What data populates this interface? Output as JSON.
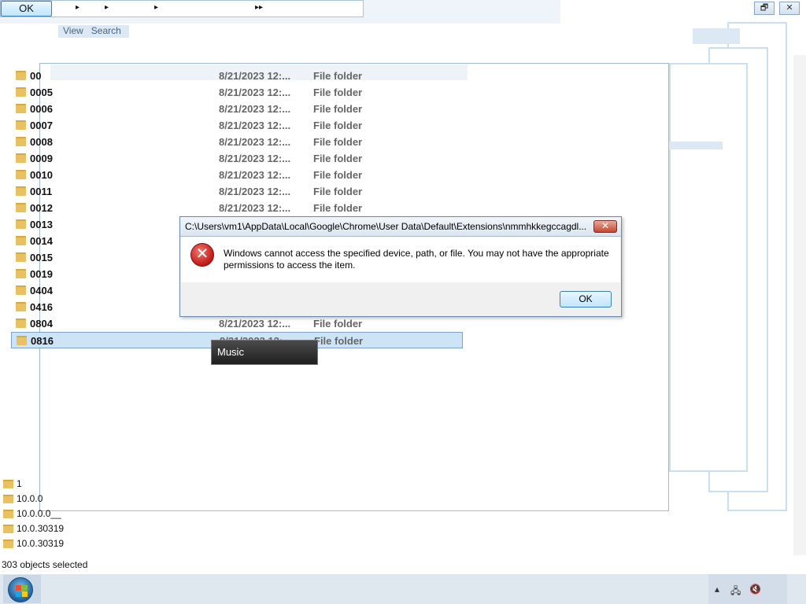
{
  "topbar": {
    "ok_label": "OK",
    "arrows": [
      "▸",
      "▸",
      "▸",
      "▸▸"
    ],
    "menu": [
      "View",
      "Search"
    ]
  },
  "window_buttons": {
    "restore": "🗗",
    "close": "✕"
  },
  "file_list": [
    {
      "name": "00",
      "date": "8/21/2023 12:...",
      "type": "File folder"
    },
    {
      "name": "0005",
      "date": "8/21/2023 12:...",
      "type": "File folder"
    },
    {
      "name": "0006",
      "date": "8/21/2023 12:...",
      "type": "File folder"
    },
    {
      "name": "0007",
      "date": "8/21/2023 12:...",
      "type": "File folder"
    },
    {
      "name": "0008",
      "date": "8/21/2023 12:...",
      "type": "File folder"
    },
    {
      "name": "0009",
      "date": "8/21/2023 12:...",
      "type": "File folder"
    },
    {
      "name": "0010",
      "date": "8/21/2023 12:...",
      "type": "File folder"
    },
    {
      "name": "0011",
      "date": "8/21/2023 12:...",
      "type": "File folder"
    },
    {
      "name": "0012",
      "date": "8/21/2023 12:...",
      "type": "File folder"
    },
    {
      "name": "0013",
      "date": "",
      "type": ""
    },
    {
      "name": "0014",
      "date": "",
      "type": ""
    },
    {
      "name": "0015",
      "date": "",
      "type": ""
    },
    {
      "name": "0019",
      "date": "",
      "type": ""
    },
    {
      "name": "0404",
      "date": "",
      "type": ""
    },
    {
      "name": "0416",
      "date": "",
      "type": ""
    },
    {
      "name": "0804",
      "date": "8/21/2023 12:...",
      "type": "File folder"
    },
    {
      "name": "0816",
      "date": "8/21/2023 12:...",
      "type": "File folder",
      "selected": true
    }
  ],
  "tree_items": [
    "1",
    "10.0.0",
    "10.0.0.0__",
    "10.0.30319",
    "10.0.30319"
  ],
  "tooltip": "Music",
  "dialog": {
    "title": "C:\\Users\\vm1\\AppData\\Local\\Google\\Chrome\\User Data\\Default\\Extensions\\nmmhkkegccagdl...",
    "close_label": "✕",
    "icon": "error-icon",
    "icon_glyph": "✕",
    "message": "Windows cannot access the specified device, path, or file.  You may not have the appropriate permissions to access the item.",
    "ok_label": "OK"
  },
  "status": {
    "selection": "303 objects selected"
  },
  "tray": {
    "show_hidden": "▴",
    "network": "🖧",
    "volume": "🔇"
  }
}
